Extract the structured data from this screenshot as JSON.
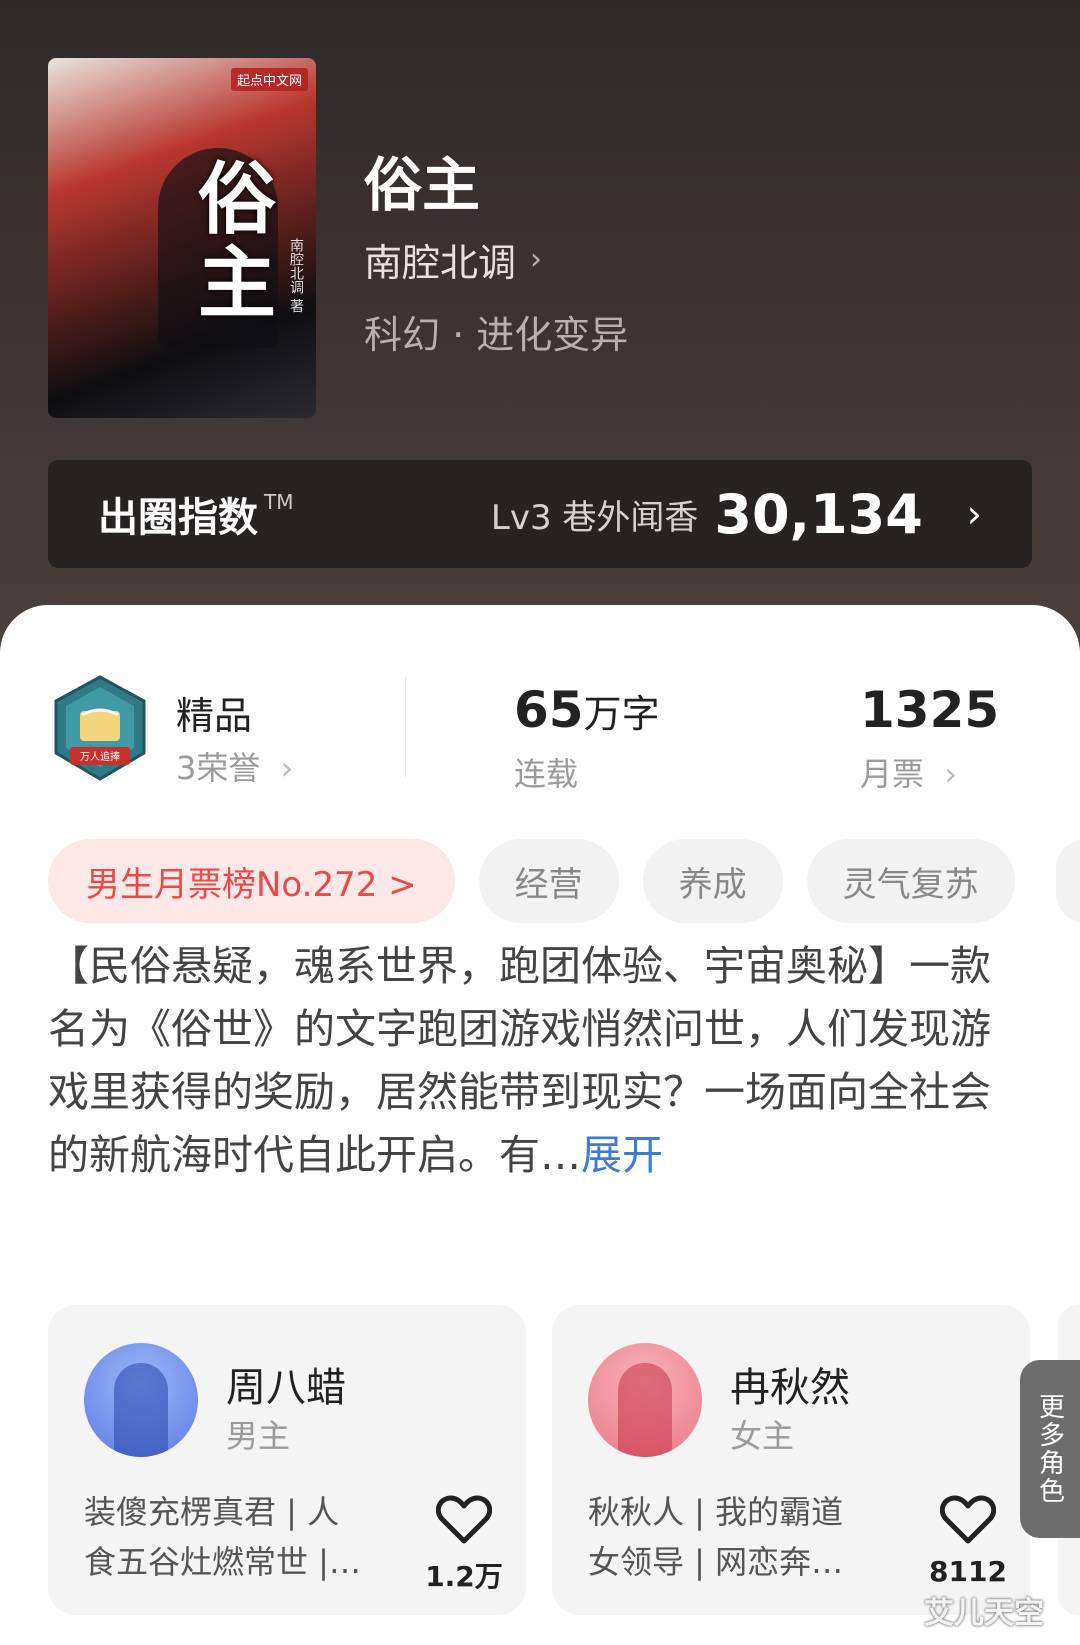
{
  "book": {
    "cover": {
      "publisher": "起点中文网",
      "title": "俗主",
      "author_line": "南腔北调 著"
    },
    "title": "俗主",
    "author": "南腔北调",
    "genre": "科幻 · 进化变异"
  },
  "index_bar": {
    "label": "出圈指数",
    "tm": "TM",
    "level": "Lv3 巷外闻香",
    "value": "30,134"
  },
  "stats": {
    "badge_text": "万人追捧",
    "quality": "精品",
    "honors": "3荣誉",
    "words_number": "65",
    "words_unit": "万字",
    "status": "连载",
    "monthly_votes": "1325",
    "monthly_votes_label": "月票"
  },
  "tags": [
    "男生月票榜No.272 >",
    "经营",
    "养成",
    "灵气复苏"
  ],
  "description": {
    "text": "【民俗悬疑，魂系世界，跑团体验、宇宙奥秘】一款名为《俗世》的文字跑团游戏悄然问世，人们发现游戏里获得的奖励，居然能带到现实？一场面向全社会的新航海时代自此开启。有…",
    "expand": "展开"
  },
  "characters": [
    {
      "name": "周八蜡",
      "role": "男主",
      "tags_line1": "装傻充楞真君 | 人",
      "tags_line2": "食五谷灶燃常世 |…",
      "likes": "1.2万"
    },
    {
      "name": "冉秋然",
      "role": "女主",
      "tags_line1": "秋秋人 | 我的霸道",
      "tags_line2": "女领导 | 网恋奔…",
      "likes": "8112"
    }
  ],
  "more_roles": "更多角色",
  "watermark": "艾儿天空"
}
